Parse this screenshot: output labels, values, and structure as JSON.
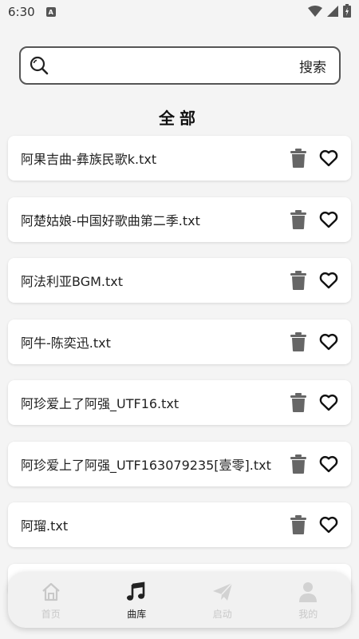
{
  "status": {
    "time": "6:30",
    "a_badge": "A"
  },
  "search": {
    "placeholder": "",
    "button_label": "搜索"
  },
  "section_title": "全部",
  "songs": [
    "阿果吉曲-彝族民歌k.txt",
    "阿楚姑娘-中国好歌曲第二季.txt",
    "阿法利亚BGM.txt",
    "阿牛-陈奕迅.txt",
    "阿珍爱上了阿强_UTF16.txt",
    "阿珍爱上了阿强_UTF163079235[壹零].txt",
    "阿瑠.txt"
  ],
  "nav": {
    "items": [
      {
        "label": "首页",
        "icon": "home-icon",
        "active": false
      },
      {
        "label": "曲库",
        "icon": "music-note-icon",
        "active": true
      },
      {
        "label": "启动",
        "icon": "send-icon",
        "active": false
      },
      {
        "label": "我的",
        "icon": "user-icon",
        "active": false
      }
    ]
  },
  "colors": {
    "inactive": "#c8c8c8",
    "active": "#222222",
    "trash": "#666666"
  }
}
